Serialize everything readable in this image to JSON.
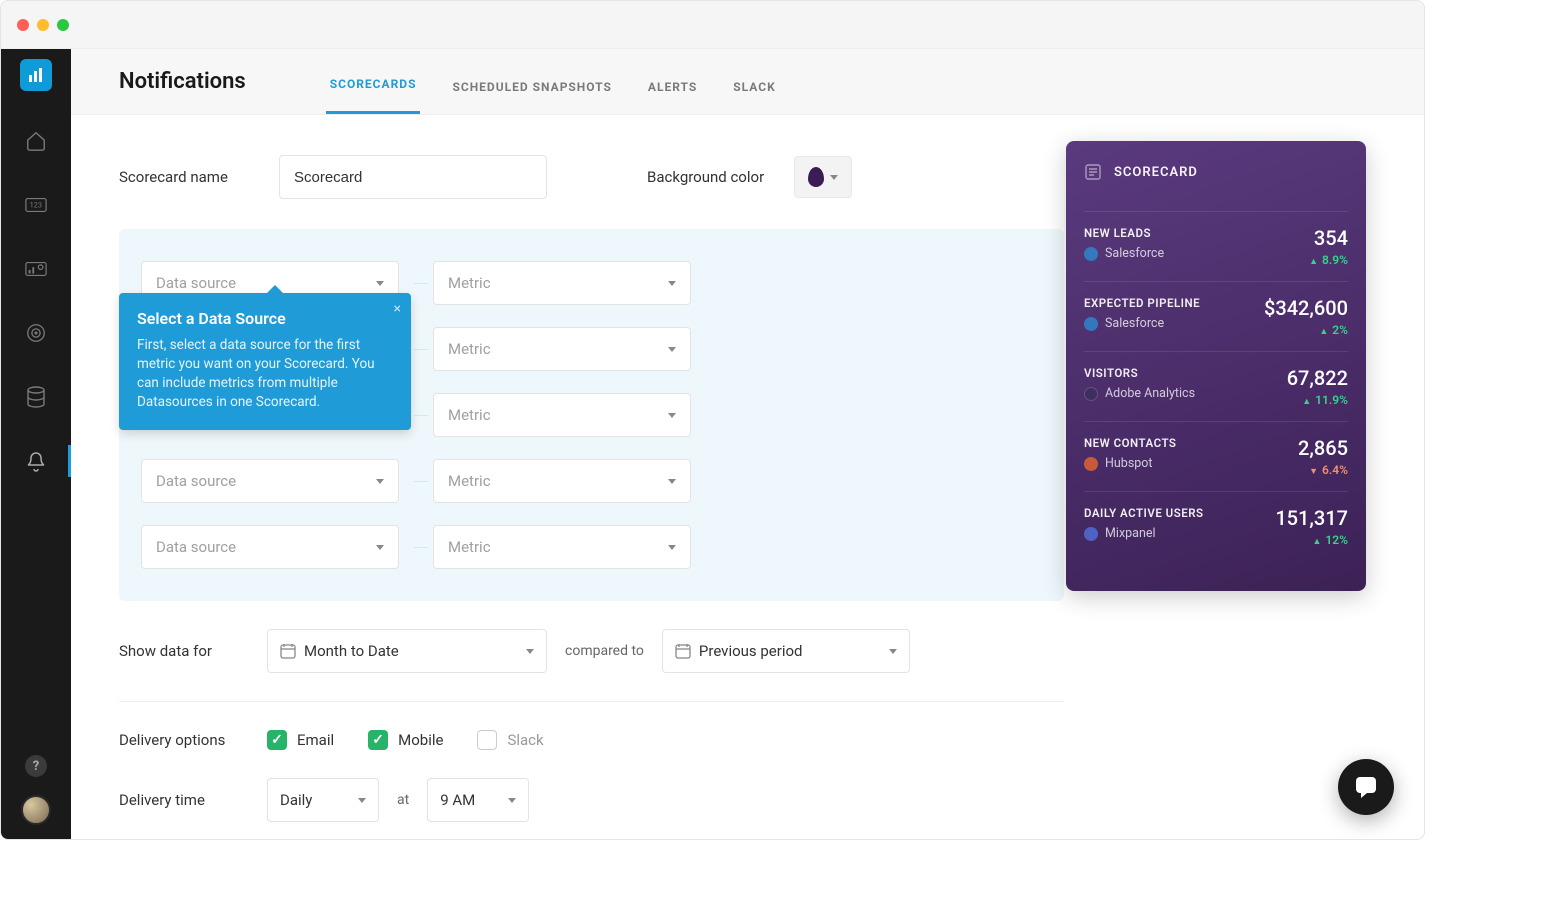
{
  "page": {
    "title": "Notifications",
    "tabs": [
      {
        "label": "Scorecards",
        "active": true
      },
      {
        "label": "Scheduled Snapshots",
        "active": false
      },
      {
        "label": "Alerts",
        "active": false
      },
      {
        "label": "Slack",
        "active": false
      }
    ]
  },
  "form": {
    "scorecard_name_label": "Scorecard name",
    "scorecard_name_value": "Scorecard",
    "bg_color_label": "Background color",
    "data_source_placeholder": "Data source",
    "metric_placeholder": "Metric",
    "row_count": 5,
    "show_data_label": "Show data for",
    "show_data_value": "Month to Date",
    "compared_to_label": "compared to",
    "compared_to_value": "Previous period",
    "delivery_options_label": "Delivery options",
    "delivery_options": [
      {
        "label": "Email",
        "checked": true,
        "muted": false
      },
      {
        "label": "Mobile",
        "checked": true,
        "muted": false
      },
      {
        "label": "Slack",
        "checked": false,
        "muted": true
      }
    ],
    "delivery_time_label": "Delivery time",
    "delivery_frequency": "Daily",
    "delivery_at_label": "at",
    "delivery_hour": "9 AM"
  },
  "coach": {
    "title": "Select a Data Source",
    "body": "First, select a data source for the first metric you want on your Scorecard. You can include metrics from multiple Datasources in one Scorecard."
  },
  "scorecard": {
    "title": "SCORECARD",
    "items": [
      {
        "name": "NEW LEADS",
        "value": "354",
        "source": "Salesforce",
        "source_badge": "sf",
        "delta": "8.9%",
        "direction": "up"
      },
      {
        "name": "EXPECTED PIPELINE",
        "value": "$342,600",
        "source": "Salesforce",
        "source_badge": "sf",
        "delta": "2%",
        "direction": "up"
      },
      {
        "name": "VISITORS",
        "value": "67,822",
        "source": "Adobe Analytics",
        "source_badge": "aa",
        "delta": "11.9%",
        "direction": "up"
      },
      {
        "name": "NEW CONTACTS",
        "value": "2,865",
        "source": "Hubspot",
        "source_badge": "hs",
        "delta": "6.4%",
        "direction": "down"
      },
      {
        "name": "DAILY ACTIVE USERS",
        "value": "151,317",
        "source": "Mixpanel",
        "source_badge": "mp",
        "delta": "12%",
        "direction": "up"
      }
    ]
  }
}
